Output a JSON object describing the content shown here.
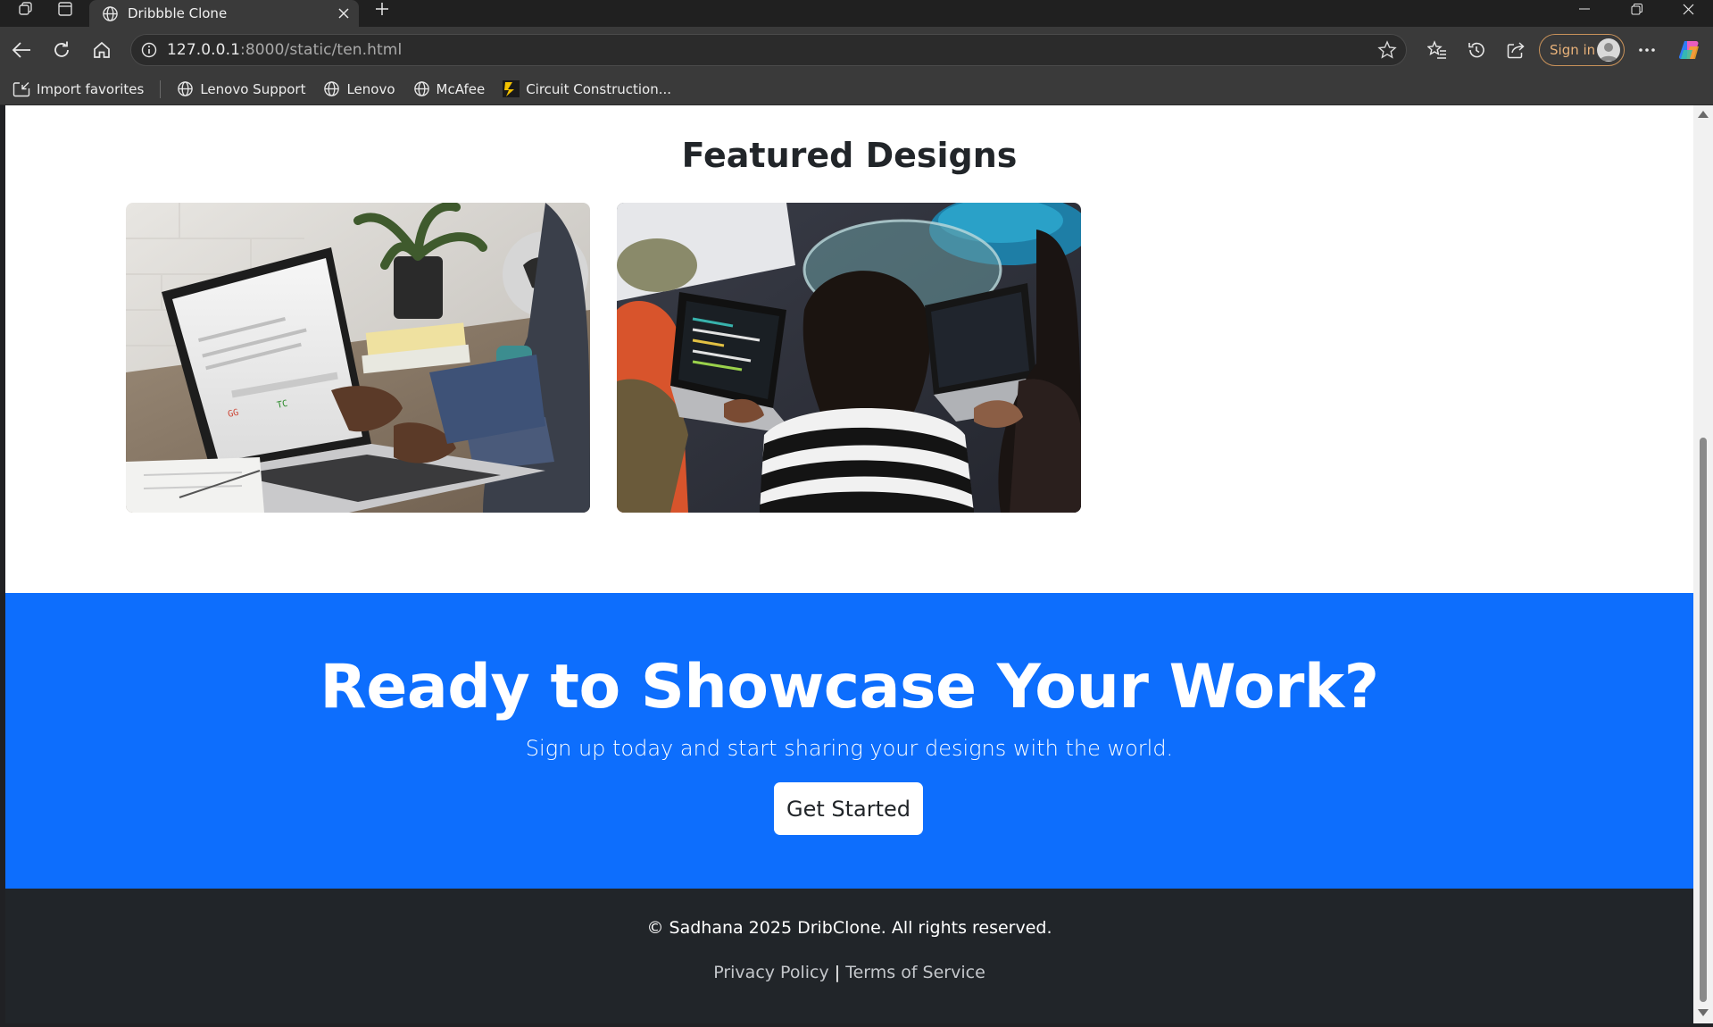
{
  "browser": {
    "tab_title": "Dribbble Clone",
    "url_host": "127.0.0.1",
    "url_rest": ":8000/static/ten.html",
    "signin_label": "Sign in"
  },
  "favorites": [
    {
      "label": "Import favorites",
      "icon": "import-icon"
    },
    {
      "label": "Lenovo Support",
      "icon": "globe-icon"
    },
    {
      "label": "Lenovo",
      "icon": "globe-icon"
    },
    {
      "label": "McAfee",
      "icon": "globe-icon"
    },
    {
      "label": "Circuit Construction...",
      "icon": "phet-icon"
    }
  ],
  "featured": {
    "title": "Featured Designs",
    "cards": [
      {
        "name": "laptop-desk-photo"
      },
      {
        "name": "coding-group-photo"
      }
    ]
  },
  "cta": {
    "title": "Ready to Showcase Your Work?",
    "subtitle": "Sign up today and start sharing your designs with the world.",
    "button": "Get Started",
    "color": "#0d6efd"
  },
  "footer": {
    "copyright": "© Sadhana 2025 DribClone. All rights reserved.",
    "privacy": "Privacy Policy",
    "separator": "|",
    "terms": "Terms of Service"
  }
}
